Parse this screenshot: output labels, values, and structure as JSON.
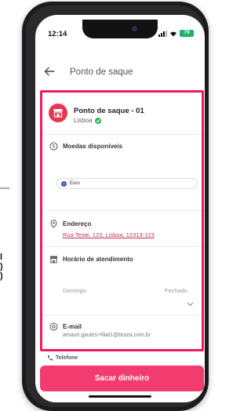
{
  "status_bar": {
    "time": "12:14",
    "battery": "79"
  },
  "header": {
    "title": "Ponto de saque"
  },
  "point": {
    "name": "Ponto de saque - 01",
    "city": "Lisboa"
  },
  "currencies": {
    "label": "Moedas disponíveis",
    "items": [
      {
        "name": "Euro"
      }
    ]
  },
  "address": {
    "label": "Endereço",
    "value": "Rua Teste, 123, Lisboa, 12313-123"
  },
  "hours": {
    "label": "Horário de atendimento",
    "day": "Domingo",
    "status": "Fechado"
  },
  "email": {
    "label": "E-mail",
    "value": "amauri.gaules+filial1@braza.com.br"
  },
  "phone": {
    "label": "Telefone"
  },
  "cta": {
    "label": "Sacar dinheiro"
  },
  "colors": {
    "accent": "#f23b6f",
    "highlight_border": "#ec1c5a",
    "verified": "#27b55e",
    "battery": "#24b16b"
  }
}
